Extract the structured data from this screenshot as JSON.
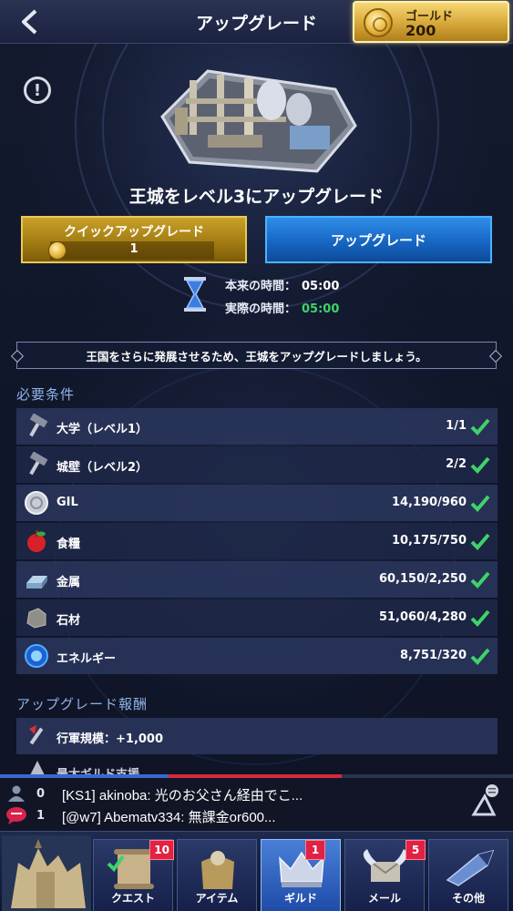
{
  "header": {
    "title": "アップグレード",
    "gold_label": "ゴールド",
    "gold_value": "200"
  },
  "upgrade": {
    "title": "王城をレベル3にアップグレード",
    "quick_label": "クイックアップグレード",
    "quick_cost": "1",
    "normal_label": "アップグレード",
    "original_time_label": "本来の時間：",
    "original_time": "05:00",
    "actual_time_label": "実際の時間：",
    "actual_time": "05:00"
  },
  "banner": "王国をさらに発展させるため、王城をアップグレードしましょう。",
  "requirements": {
    "heading": "必要条件",
    "items": [
      {
        "name": "大学（レベル1）",
        "value": "1/1",
        "icon": "hammer-icon",
        "met": true
      },
      {
        "name": "城壁（レベル2）",
        "value": "2/2",
        "icon": "hammer-icon",
        "met": true
      },
      {
        "name": "GIL",
        "value": "14,190/960",
        "icon": "gil-coin-icon",
        "met": true
      },
      {
        "name": "食糧",
        "value": "10,175/750",
        "icon": "apple-icon",
        "met": true
      },
      {
        "name": "金属",
        "value": "60,150/2,250",
        "icon": "metal-ingot-icon",
        "met": true
      },
      {
        "name": "石材",
        "value": "51,060/4,280",
        "icon": "stone-icon",
        "met": true
      },
      {
        "name": "エネルギー",
        "value": "8,751/320",
        "icon": "energy-orb-icon",
        "met": true
      }
    ]
  },
  "rewards": {
    "heading": "アップグレード報酬",
    "items": [
      {
        "name": "行軍規模：+1,000",
        "icon": "march-icon"
      },
      {
        "name": "最大ギルド支援",
        "icon": "guild-support-icon"
      }
    ]
  },
  "chat": {
    "user_count": "0",
    "message_count": "1",
    "lines": [
      "[KS1] akinoba: 光のお父さん経由でこ...",
      "[@w7] Abematv334: 無課金or600..."
    ]
  },
  "nav": {
    "items": [
      {
        "label": "クエスト",
        "badge": "10"
      },
      {
        "label": "アイテム",
        "badge": ""
      },
      {
        "label": "ギルド",
        "badge": "1"
      },
      {
        "label": "メール",
        "badge": "5"
      },
      {
        "label": "その他",
        "badge": ""
      }
    ]
  },
  "colors": {
    "gold": "#d6a83a",
    "blue_button": "#1563c0",
    "check_green": "#3ed36a",
    "badge_red": "#e02244"
  }
}
